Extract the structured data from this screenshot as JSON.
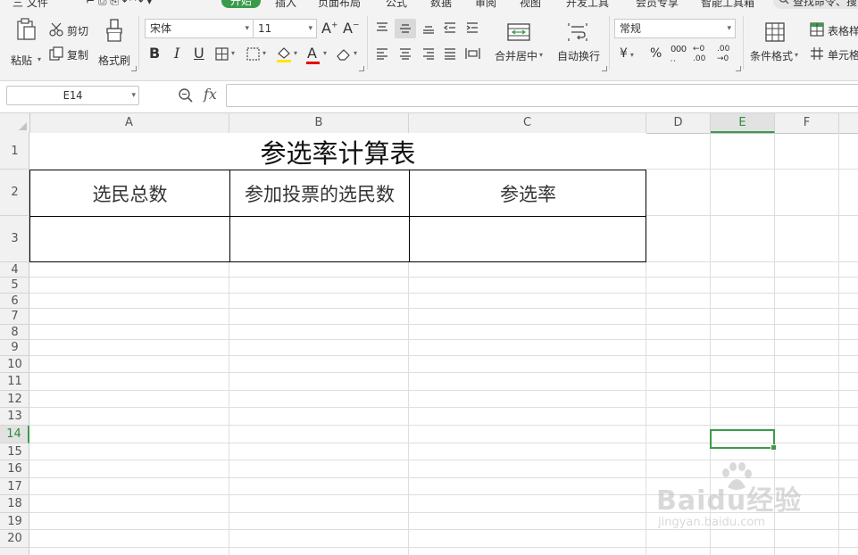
{
  "menu": {
    "file": "三 文件",
    "home_tab": "开始",
    "items": [
      "插入",
      "页面布局",
      "公式",
      "数据",
      "审阅",
      "视图",
      "开发工具",
      "会员专享",
      "智能工具箱"
    ],
    "search": "查找命令、搜"
  },
  "ribbon": {
    "paste": "粘贴",
    "cut": "剪切",
    "copy": "复制",
    "format_painter": "格式刷",
    "font_name": "宋体",
    "font_size": "11",
    "bold": "B",
    "italic": "I",
    "underline": "U",
    "font_color_letter": "A",
    "merge_center": "合并居中",
    "wrap_text": "自动换行",
    "number_format": "常规",
    "currency": "¥",
    "percent": "%",
    "thousands": "000",
    "dec_inc": ".00",
    "dec_dec": ".00",
    "conditional_format": "条件格式",
    "table_style": "表格样",
    "cell_style": "单元格",
    "accent_color": "#3a9b4a",
    "font_color_swatch": "#e60000",
    "fill_color_swatch": "#ffe600"
  },
  "formula_bar": {
    "cell_ref": "E14",
    "fx": "fx",
    "formula": ""
  },
  "sheet": {
    "columns": [
      "A",
      "B",
      "C",
      "D",
      "E",
      "F"
    ],
    "rows": [
      "1",
      "2",
      "3",
      "4",
      "5",
      "6",
      "7",
      "8",
      "9",
      "10",
      "11",
      "12",
      "13",
      "14",
      "15",
      "16",
      "17",
      "18",
      "19",
      "20"
    ],
    "active_column": "E",
    "active_row": "14",
    "title": "参选率计算表",
    "headers": [
      "选民总数",
      "参加投票的选民数",
      "参选率"
    ],
    "values": [
      "",
      "",
      ""
    ]
  },
  "watermark": {
    "main": "Baidu经验",
    "sub": "jingyan.baidu.com"
  }
}
